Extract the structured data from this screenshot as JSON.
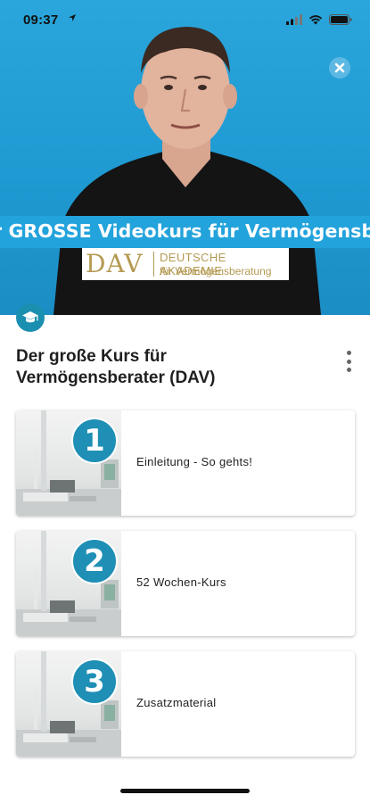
{
  "status_bar": {
    "time": "09:37"
  },
  "hero": {
    "banner_text": "r GROSSE Videokurs für Vermögensberat",
    "logo": {
      "mark": "DAV",
      "line1": "DEUTSCHE AKADEMIE",
      "line2": "für Vermögensberatung"
    }
  },
  "course": {
    "title": "Der große Kurs für Vermögensberater (DAV)"
  },
  "modules": [
    {
      "number": "1",
      "label": "Einleitung - So gehts!"
    },
    {
      "number": "2",
      "label": "52 Wochen-Kurs"
    },
    {
      "number": "3",
      "label": "Zusatzmaterial"
    }
  ],
  "colors": {
    "accent": "#1f8fb5",
    "hero_bg": "#23a3dc",
    "logo_gold": "#b49a52"
  }
}
